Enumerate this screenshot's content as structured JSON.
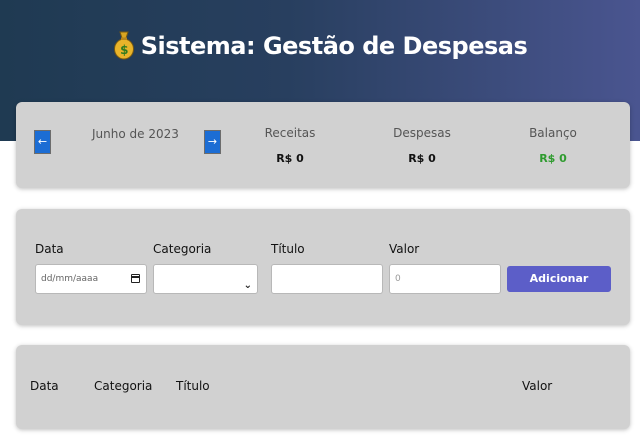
{
  "header": {
    "title": "Sistema: Gestão de Despesas",
    "icon": "money-bag-icon"
  },
  "info": {
    "prev_icon": "arrow-left-icon",
    "next_icon": "arrow-right-icon",
    "prev_glyph": "←",
    "next_glyph": "→",
    "month": "Junho de 2023",
    "stats": {
      "receitas": {
        "label": "Receitas",
        "value": "R$ 0"
      },
      "despesas": {
        "label": "Despesas",
        "value": "R$ 0"
      },
      "balanco": {
        "label": "Balanço",
        "value": "R$ 0",
        "color": "#2e9b2e"
      }
    }
  },
  "form": {
    "data": {
      "label": "Data",
      "placeholder": "dd/mm/aaaa"
    },
    "categoria": {
      "label": "Categoria",
      "value": ""
    },
    "titulo": {
      "label": "Título",
      "value": ""
    },
    "valor": {
      "label": "Valor",
      "value": "0"
    },
    "submit_label": "Adicionar",
    "accent": "#5c5ec8"
  },
  "table": {
    "columns": [
      "Data",
      "Categoria",
      "Título",
      "Valor"
    ],
    "rows": []
  },
  "colors": {
    "header_gradient_start": "#1f3a52",
    "header_gradient_end": "#4a5590",
    "card_bg": "#d1d1d1",
    "arrow_btn": "#1c6dd4"
  }
}
